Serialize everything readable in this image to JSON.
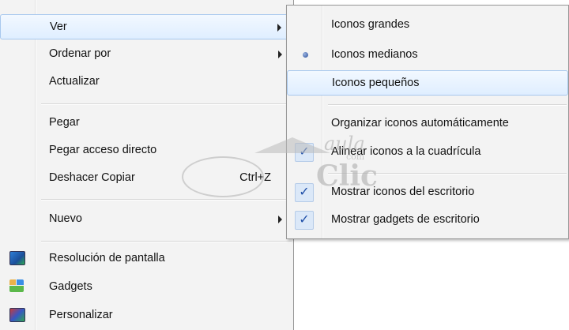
{
  "main_menu": {
    "ver": {
      "label": "Ver",
      "has_submenu": true
    },
    "ordenar_por": {
      "label": "Ordenar por",
      "has_submenu": true
    },
    "actualizar": {
      "label": "Actualizar"
    },
    "pegar": {
      "label": "Pegar"
    },
    "pegar_acceso_directo": {
      "label": "Pegar acceso directo"
    },
    "deshacer_copiar": {
      "label": "Deshacer Copiar",
      "shortcut": "Ctrl+Z"
    },
    "nuevo": {
      "label": "Nuevo",
      "has_submenu": true
    },
    "resolucion": {
      "label": "Resolución de pantalla",
      "icon": "monitor-icon"
    },
    "gadgets": {
      "label": "Gadgets",
      "icon": "gadgets-icon"
    },
    "personalizar": {
      "label": "Personalizar",
      "icon": "personalize-icon"
    }
  },
  "submenu_ver": {
    "iconos_grandes": {
      "label": "Iconos grandes"
    },
    "iconos_medianos": {
      "label": "Iconos medianos",
      "selected": true
    },
    "iconos_pequenos": {
      "label": "Iconos pequeños"
    },
    "organizar": {
      "label": "Organizar iconos automáticamente"
    },
    "alinear": {
      "label": "Alinear iconos a la cuadrícula",
      "checked": true
    },
    "mostrar_iconos": {
      "label": "Mostrar iconos del escritorio",
      "checked": true
    },
    "mostrar_gadgets": {
      "label": "Mostrar gadgets de escritorio",
      "checked": true
    },
    "check_glyph": "✓"
  },
  "watermark": {
    "brand_top": "aula",
    "brand_mid": "com",
    "brand_main": "Clic"
  }
}
